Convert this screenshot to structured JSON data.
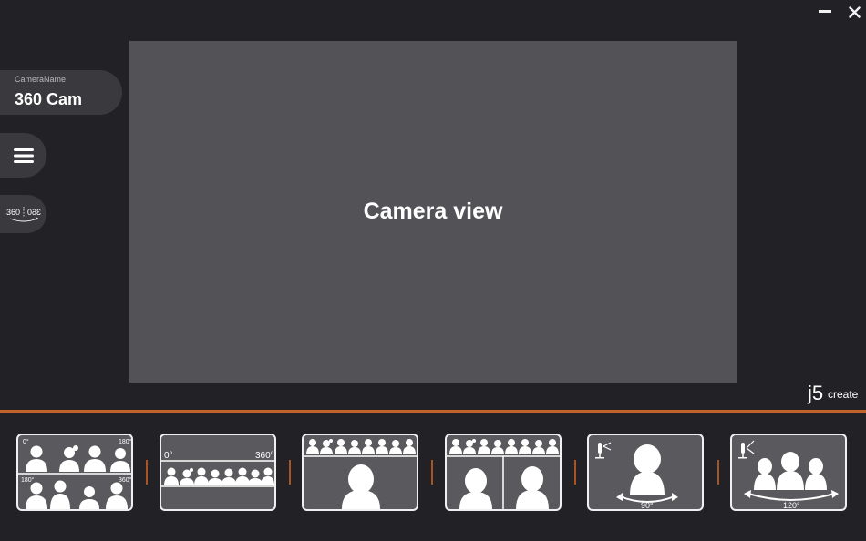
{
  "window": {
    "minimize_icon": "minimize-icon",
    "close_icon": "close-icon"
  },
  "camera": {
    "name_label": "CameraName",
    "name_value": "360 Cam"
  },
  "menu": {
    "icon": "hamburger-menu-icon"
  },
  "mode_toggle": {
    "label_left": "360",
    "label_right": "360"
  },
  "main": {
    "camera_view_text": "Camera view"
  },
  "brand": {
    "logo_prefix": "j5",
    "logo_suffix": "create"
  },
  "colors": {
    "background": "#222226",
    "panel": "#3a3a3e",
    "camera_view": "#535357",
    "accent": "#c2632a"
  },
  "modes": [
    {
      "name": "quad-view",
      "labels": [
        "0°",
        "180°",
        "180°",
        "360°"
      ]
    },
    {
      "name": "panorama-view",
      "labels": [
        "0°",
        "360°"
      ]
    },
    {
      "name": "panorama-speaker-view",
      "labels": []
    },
    {
      "name": "panorama-dual-speaker-view",
      "labels": []
    },
    {
      "name": "focus-90-view",
      "labels": [
        "90°"
      ]
    },
    {
      "name": "wide-120-view",
      "labels": [
        "120°"
      ]
    }
  ]
}
